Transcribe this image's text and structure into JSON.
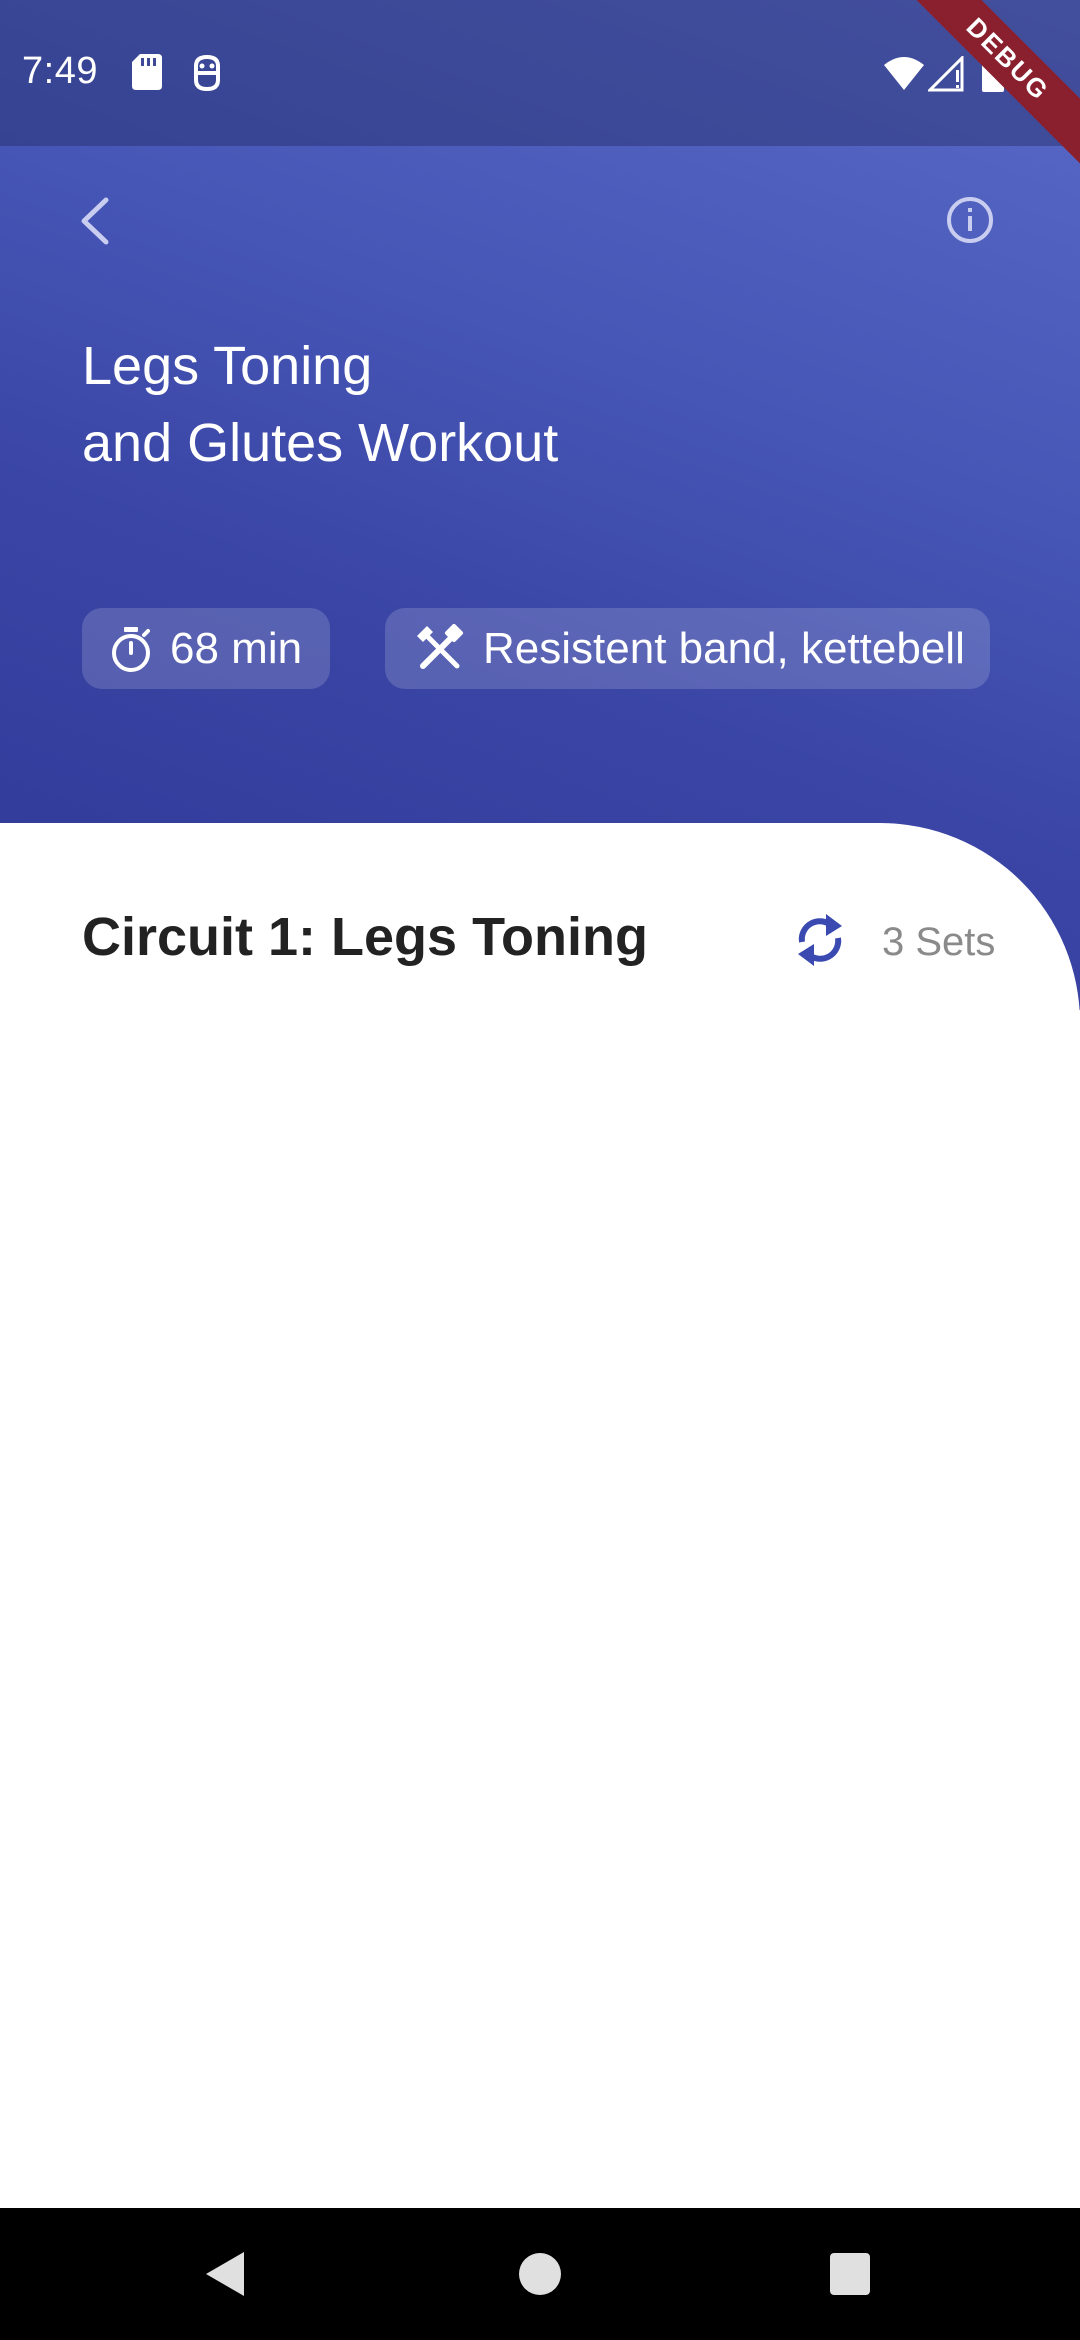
{
  "status_bar": {
    "time": "7:49",
    "left_icons": [
      "sd-card-icon",
      "debug-bridge-icon"
    ],
    "right_icons": [
      "wifi-icon",
      "cell-signal-icon",
      "battery-icon"
    ],
    "debug_banner": "DEBUG"
  },
  "header": {
    "back_icon": "chevron-left-icon",
    "info_icon": "info-circle-icon",
    "title_line1": "Legs Toning",
    "title_line2": "and Glutes Workout",
    "duration": "68 min",
    "duration_icon": "stopwatch-icon",
    "equipment": "Resistent band, kettebell",
    "equipment_icon": "tools-icon"
  },
  "circuit": {
    "title": "Circuit 1: Legs Toning",
    "sets_icon": "repeat-icon",
    "sets": "3 Sets"
  },
  "nav": {
    "back": "nav-back-icon",
    "home": "nav-home-icon",
    "recents": "nav-recents-icon"
  },
  "colors": {
    "header_gradient_start": "#5a6ac7",
    "header_gradient_end": "#2e3896",
    "accent": "#3a4ab0",
    "debug_ribbon": "#8a1f2e"
  }
}
